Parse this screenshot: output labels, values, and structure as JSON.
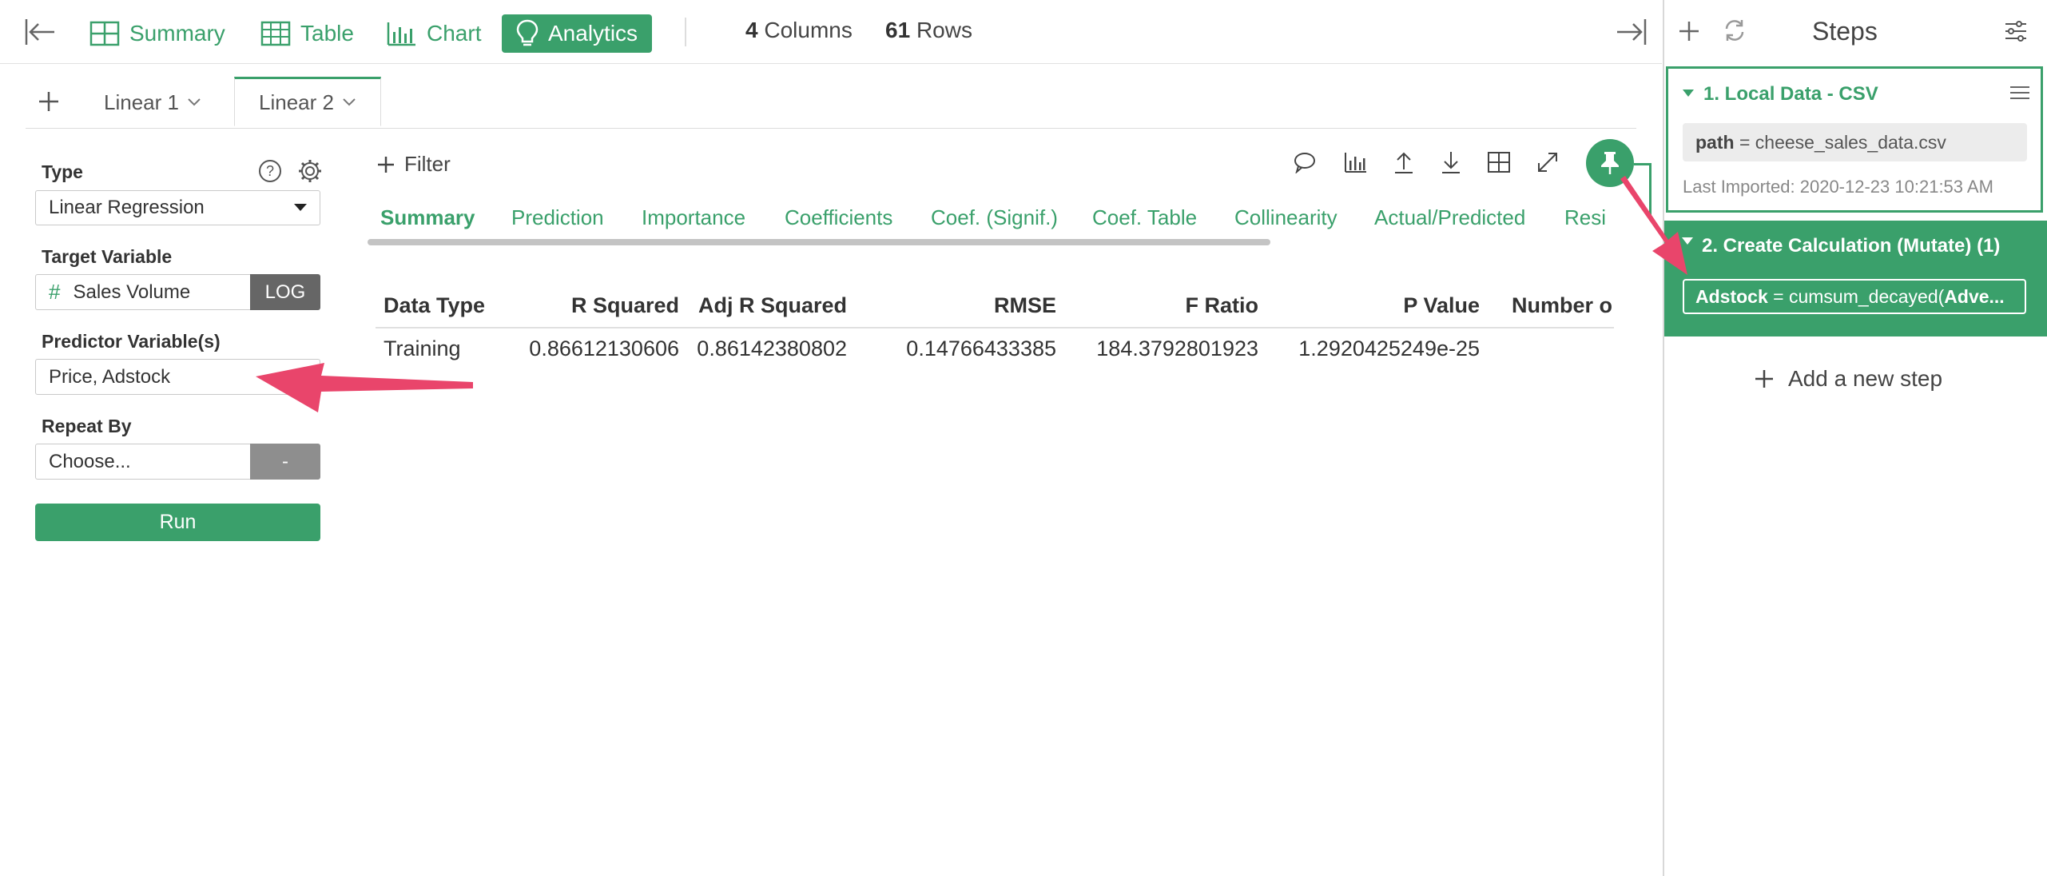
{
  "topbar": {
    "nav": [
      {
        "label": "Summary",
        "icon": "summary-grid-icon"
      },
      {
        "label": "Table",
        "icon": "table-icon"
      },
      {
        "label": "Chart",
        "icon": "bar-chart-icon"
      },
      {
        "label": "Analytics",
        "icon": "lightbulb-icon",
        "active": true
      }
    ],
    "columns_count": "4",
    "columns_label": "Columns",
    "rows_count": "61",
    "rows_label": "Rows"
  },
  "model_tabs": [
    {
      "label": "Linear 1"
    },
    {
      "label": "Linear 2",
      "active": true
    }
  ],
  "properties": {
    "type_label": "Type",
    "type_value": "Linear Regression",
    "target_label": "Target Variable",
    "target_type_symbol": "#",
    "target_value": "Sales Volume",
    "target_transform": "LOG",
    "predictor_label": "Predictor Variable(s)",
    "predictor_value": "Price, Adstock",
    "repeat_label": "Repeat By",
    "repeat_placeholder": "Choose...",
    "repeat_button": "-",
    "run_label": "Run"
  },
  "results": {
    "filter_label": "Filter",
    "tabs": [
      "Summary",
      "Prediction",
      "Importance",
      "Coefficients",
      "Coef. (Signif.)",
      "Coef. Table",
      "Collinearity",
      "Actual/Predicted",
      "Resi"
    ],
    "active_tab": "Summary",
    "table": {
      "headers": [
        "Data Type",
        "R Squared",
        "Adj R Squared",
        "RMSE",
        "F Ratio",
        "P Value",
        "Number o"
      ],
      "rows": [
        [
          "Training",
          "0.86612130606",
          "0.86142380802",
          "0.14766433385",
          "184.3792801923",
          "1.2920425249e-25",
          ""
        ]
      ]
    }
  },
  "steps_panel": {
    "title": "Steps",
    "steps": [
      {
        "title": "1. Local Data - CSV",
        "param_key": "path",
        "param_sep": " = ",
        "param_value": "cheese_sales_data.csv",
        "footer": "Last Imported: 2020-12-23 10:21:53 AM"
      },
      {
        "title": "2. Create Calculation (Mutate) (1)",
        "param_key": "Adstock",
        "param_sep": " = ",
        "param_value": "cumsum_decayed(",
        "param_value_bold": "Adve..."
      }
    ],
    "add_step_label": "Add a new step"
  },
  "colors": {
    "brand_green": "#3aa06b",
    "annotation_arrow": "#e9456b",
    "gray_button": "#8e8e8e"
  }
}
